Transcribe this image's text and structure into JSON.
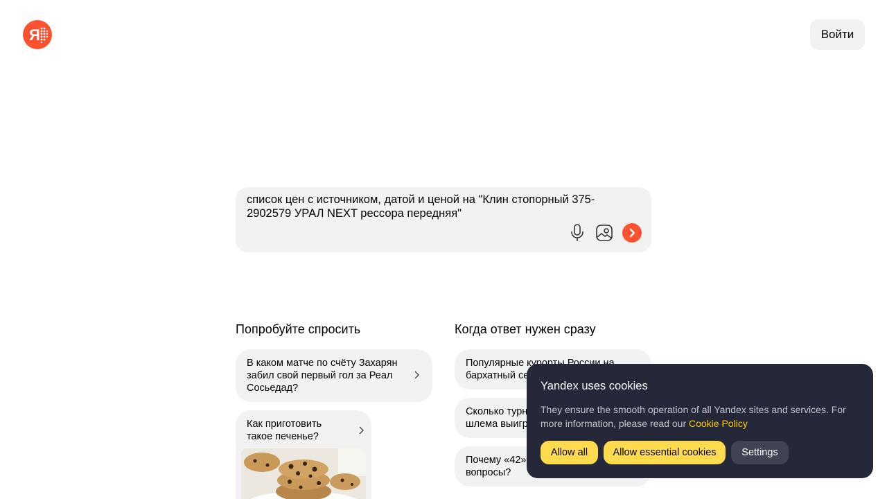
{
  "header": {
    "logo_icon": "yandex-logo-icon",
    "logo_text": "Я",
    "login_label": "Войти"
  },
  "search": {
    "query": "список цен с источником, датой и ценой на \"Клин стопорный 375-2902579 УРАЛ NEXT рессора передняя\"",
    "icons": [
      "microphone-icon",
      "image-search-icon",
      "send-arrow-icon"
    ]
  },
  "sections": {
    "try_asking": {
      "title": "Попробуйте спросить",
      "items": [
        {
          "text": "В каком матче по счёту Захарян забил свой первый гол за Реал Сосьедад?"
        },
        {
          "text": "Как приготовить такое печенье?",
          "image": "chocolate-chip-cookies-image"
        }
      ]
    },
    "quick_answer": {
      "title": "Когда ответ нужен сразу",
      "items": [
        {
          "text": "Популярные курорты России на бархатный сезон"
        },
        {
          "text": "Сколько турниров Большого шлема выиграл"
        },
        {
          "text": "Почему «42» ответ на все вопросы?"
        }
      ]
    }
  },
  "cookie_banner": {
    "title": "Yandex uses cookies",
    "text": "They ensure the smooth operation of all Yandex sites and services. For more information, please read our ",
    "link": "Cookie Policy",
    "buttons": {
      "allow_all": "Allow all",
      "allow_essential": "Allow essential cookies",
      "settings": "Settings"
    }
  },
  "colors": {
    "brand": "#fc5230",
    "surface": "#f2f2f2",
    "banner_bg": "#242838",
    "accent_yellow": "#ffdb4d",
    "link_yellow": "#ffcc00"
  }
}
